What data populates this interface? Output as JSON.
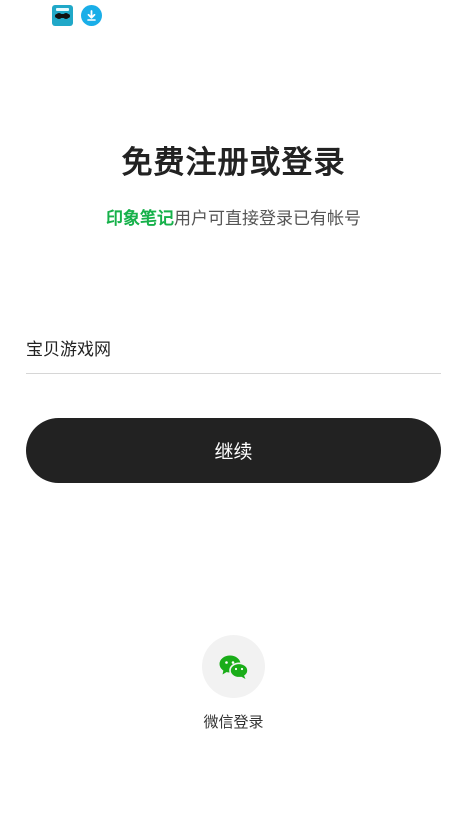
{
  "status_bar": {
    "icons": [
      "app-icon",
      "download-icon"
    ]
  },
  "header": {
    "title": "免费注册或登录",
    "subtitle_brand": "印象笔记",
    "subtitle_rest": "用户可直接登录已有帐号"
  },
  "form": {
    "account_value": "宝贝游戏网",
    "continue_label": "继续"
  },
  "social_login": {
    "wechat_label": "微信登录"
  },
  "colors": {
    "brand_green": "#16b14a",
    "button_dark": "#222222",
    "wechat_green": "#1aad19"
  }
}
